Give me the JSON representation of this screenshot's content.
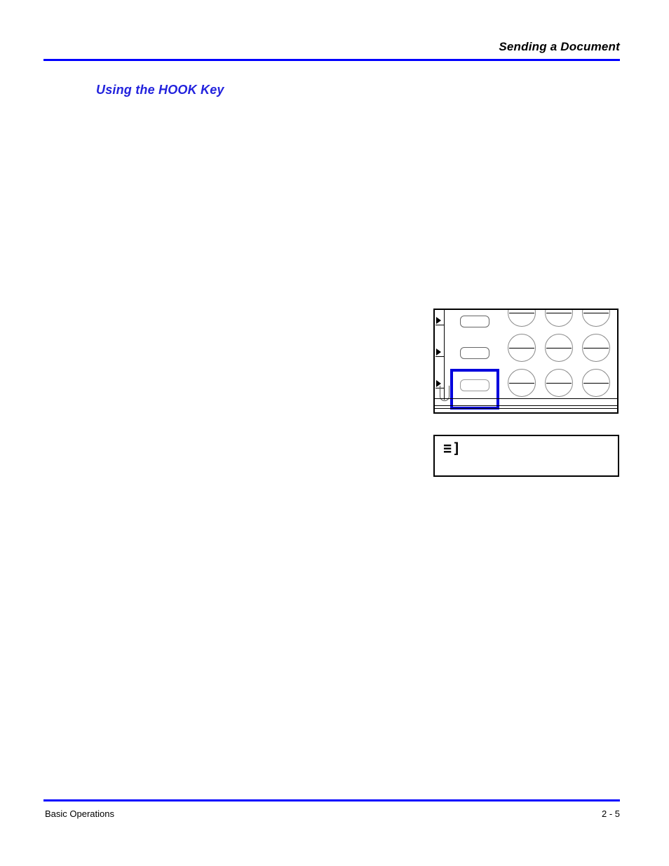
{
  "header": {
    "title": "Sending a Document",
    "rule_color": "#0000FF"
  },
  "section": {
    "heading": "Using the HOOK Key",
    "heading_color": "#2222DD"
  },
  "body": {
    "text": ""
  },
  "figures": {
    "control_panel": {
      "caption": "",
      "highlight_color": "#0000DD",
      "highlighted_key": "HOOK",
      "function_keys": [
        "",
        "",
        ""
      ],
      "led_indicators": [
        "",
        "",
        ""
      ],
      "keypad_rows": [
        [
          "",
          "",
          ""
        ],
        [
          "",
          "",
          ""
        ],
        [
          "",
          "",
          ""
        ]
      ]
    },
    "lcd_display": {
      "line1": "≡]",
      "line2": ""
    }
  },
  "footer": {
    "left": "Basic Operations",
    "page_number": "2 - 5",
    "rule_color": "#0000FF"
  }
}
